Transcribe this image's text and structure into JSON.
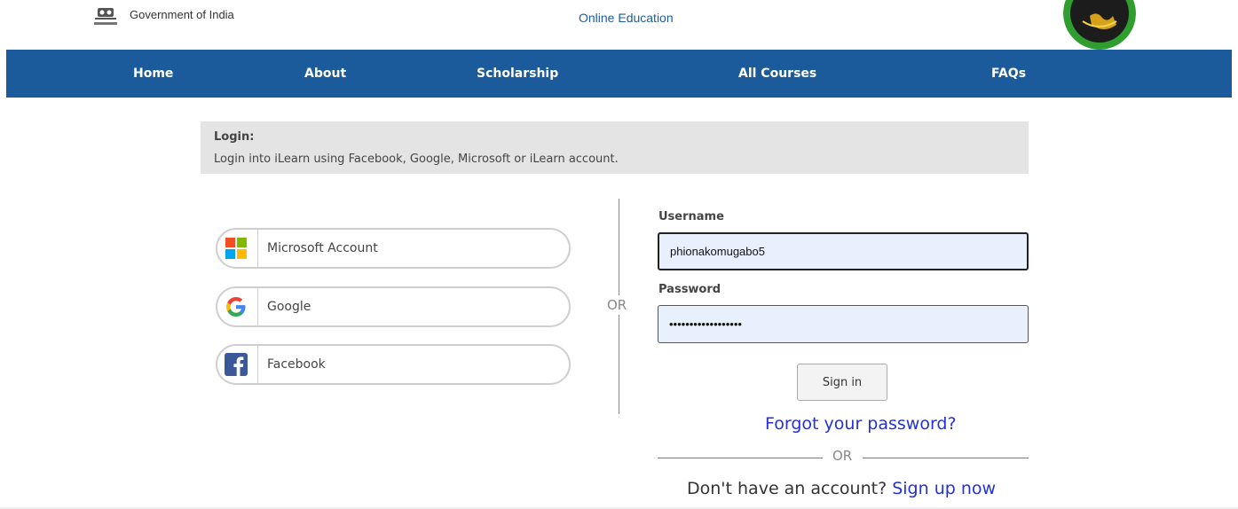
{
  "header": {
    "government_text": "Government of India",
    "site_title": "Online Education"
  },
  "nav": {
    "items": [
      {
        "label": "Home"
      },
      {
        "label": "About"
      },
      {
        "label": "Scholarship"
      },
      {
        "label": "All Courses"
      },
      {
        "label": "FAQs"
      }
    ]
  },
  "login_banner": {
    "title": "Login:",
    "subtitle": "Login into iLearn using Facebook, Google, Microsoft or iLearn account."
  },
  "social": {
    "buttons": [
      {
        "label": "Microsoft Account",
        "icon": "microsoft-logo-icon"
      },
      {
        "label": "Google",
        "icon": "google-logo-icon"
      },
      {
        "label": "Facebook",
        "icon": "facebook-logo-icon"
      }
    ],
    "or_label": "OR"
  },
  "form": {
    "username_label": "Username",
    "username_value": "phionakomugabo5",
    "password_label": "Password",
    "password_value": "••••••••••••••••••",
    "signin_label": "Sign in",
    "forgot_label": "Forgot your password?",
    "or_label": "OR",
    "no_account_text": "Don't have an account?",
    "signup_label": "Sign up now"
  },
  "colors": {
    "nav_bg": "#1c5b9b",
    "link": "#2331d6",
    "input_bg": "#e8f0fe",
    "banner_bg": "#e4e4e4"
  }
}
